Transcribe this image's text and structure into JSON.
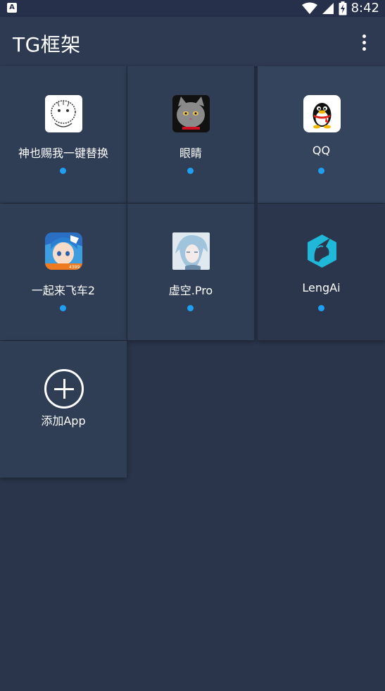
{
  "status": {
    "time": "8:42",
    "notification_icon": "a-badge-icon",
    "icons": [
      "wifi-icon",
      "signal-icon",
      "battery-charging-icon"
    ]
  },
  "appbar": {
    "title": "TG框架",
    "menu_icon": "more-vert-icon"
  },
  "apps": [
    {
      "label": "神也赐我一键替换",
      "status": "active"
    },
    {
      "label": "眼睛",
      "status": "active"
    },
    {
      "label": "QQ",
      "status": "active"
    },
    {
      "label": "一起来飞车2",
      "status": "active"
    },
    {
      "label": "虚空.Pro",
      "status": "active"
    },
    {
      "label": "LengAi",
      "status": "active"
    }
  ],
  "add_tile": {
    "label": "添加App",
    "icon": "add-circle-icon"
  },
  "colors": {
    "background": "#2a344a",
    "tile": "#2f3d55",
    "appbar": "#2e3a52",
    "status_dot": "#1e9ff2",
    "lengai_icon": "#1fb8d8"
  }
}
